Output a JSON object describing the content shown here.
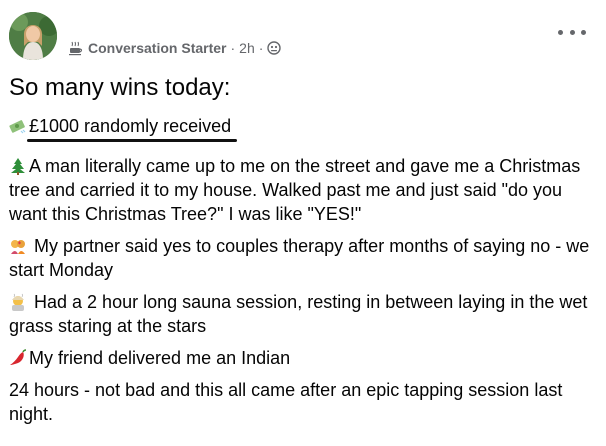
{
  "post": {
    "badge_label": "Conversation Starter",
    "separator": "·",
    "time": "2h",
    "headline": "So many wins today:",
    "paragraphs": [
      {
        "emoji": "money-icon",
        "text": "£1000 randomly received"
      },
      {
        "emoji": "christmas-tree-icon",
        "text": "A man literally came up to me on the street and gave me a Christmas tree and carried it to my house. Walked past me and just said \"do you want this Christmas Tree?\" I was like \"YES!\""
      },
      {
        "emoji": "couple-kiss-icon",
        "text": "My partner said yes to couples therapy after months of saying no - we start Monday"
      },
      {
        "emoji": "sauna-person-icon",
        "text": "Had a 2 hour long sauna session, resting in between laying in the wet grass staring at the stars"
      },
      {
        "emoji": "chili-pepper-icon",
        "text": "My friend delivered me an Indian"
      },
      {
        "emoji": "",
        "text": "24 hours - not bad and this all came after an epic tapping session last night."
      }
    ]
  },
  "colors": {
    "meta_text": "#65676b",
    "body_text": "#050505",
    "underline": "#111111"
  }
}
